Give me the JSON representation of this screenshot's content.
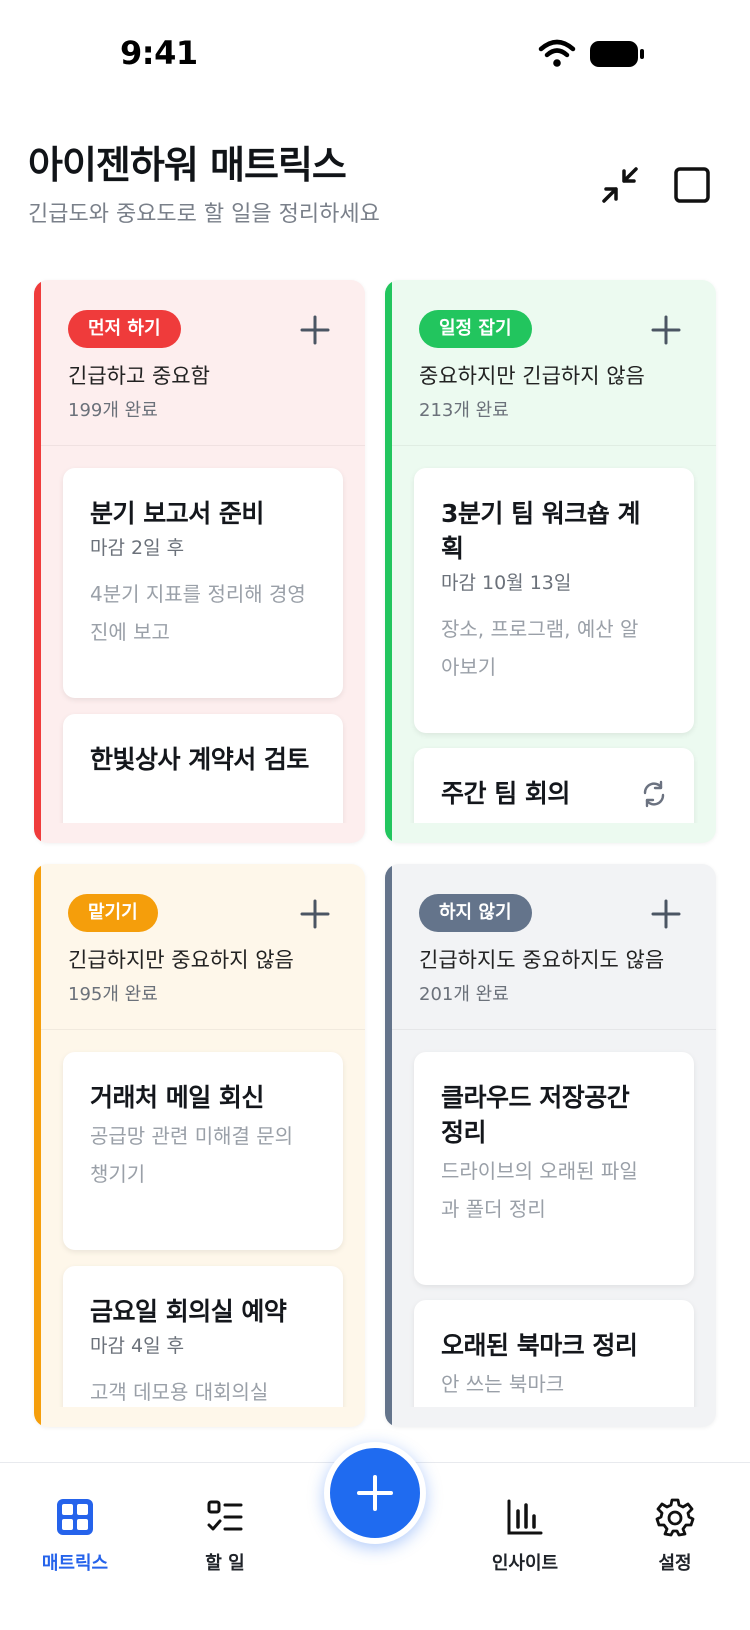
{
  "status_bar": {
    "time": "9:41"
  },
  "header": {
    "title": "아이젠하워 매트릭스",
    "subtitle": "긴급도와 중요도로 할 일을 정리하세요",
    "collapse_icon": "collapse-arrows-icon",
    "select_icon": "square-icon"
  },
  "quadrants": [
    {
      "badge": "먼저 하기",
      "subtitle": "긴급하고 중요함",
      "completed": "199개 완료",
      "accent_color": "#ef3b3b",
      "bg_color": "#fdeeee",
      "tasks": [
        {
          "title": "분기 보고서 준비",
          "due": "마감 2일 후",
          "description": "4분기 지표를 정리해 경영진에 보고"
        },
        {
          "title": "한빛상사 계약서 검토",
          "due": "",
          "description": ""
        }
      ]
    },
    {
      "badge": "일정 잡기",
      "subtitle": "중요하지만 긴급하지 않음",
      "completed": "213개 완료",
      "accent_color": "#22c55e",
      "bg_color": "#ecfaf0",
      "tasks": [
        {
          "title": "3분기 팀 워크숍 계획",
          "due": "마감 10월 13일",
          "description": "장소, 프로그램, 예산 알아보기"
        },
        {
          "title": "주간 팀 회의",
          "due": "",
          "description": "",
          "recurring_icon": "repeat-icon"
        }
      ]
    },
    {
      "badge": "맡기기",
      "subtitle": "긴급하지만 중요하지 않음",
      "completed": "195개 완료",
      "accent_color": "#f59e0b",
      "bg_color": "#fef7ea",
      "tasks": [
        {
          "title": "거래처 메일 회신",
          "due": "",
          "description": "공급망 관련 미해결 문의 챙기기"
        },
        {
          "title": "금요일 회의실 예약",
          "due": "마감 4일 후",
          "description": "고객 데모용 대회의실"
        }
      ]
    },
    {
      "badge": "하지 않기",
      "subtitle": "긴급하지도 중요하지도 않음",
      "completed": "201개 완료",
      "accent_color": "#64748b",
      "bg_color": "#f2f3f5",
      "tasks": [
        {
          "title": "클라우드 저장공간 정리",
          "due": "",
          "description": "드라이브의 오래된 파일과 폴더 정리"
        },
        {
          "title": "오래된 북마크 정리",
          "due": "",
          "description": "안 쓰는 북마크"
        }
      ]
    }
  ],
  "bottom_nav": {
    "items": [
      {
        "label": "매트릭스",
        "icon": "grid-icon",
        "active": true
      },
      {
        "label": "할 일",
        "icon": "checklist-icon",
        "active": false
      },
      {
        "label": "인사이트",
        "icon": "bar-chart-icon",
        "active": false
      },
      {
        "label": "설정",
        "icon": "gear-icon",
        "active": false
      }
    ],
    "fab_icon": "plus-icon"
  },
  "colors": {
    "primary": "#1f6bf0",
    "active_nav": "#2563eb"
  }
}
